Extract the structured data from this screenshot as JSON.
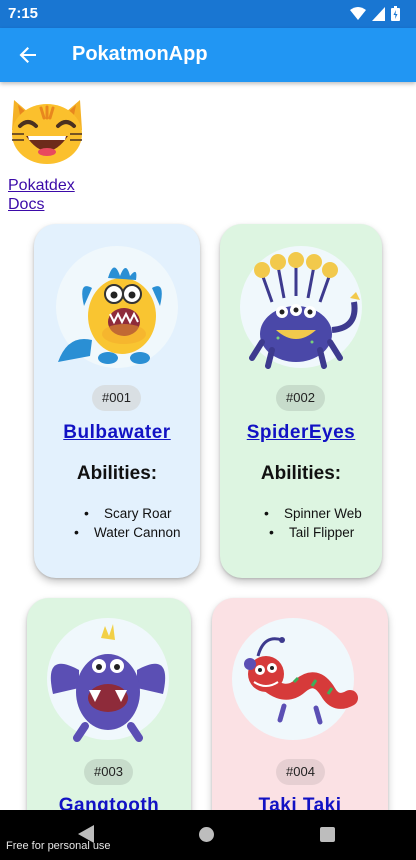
{
  "status_bar": {
    "time": "7:15"
  },
  "app_bar": {
    "title": "PokatmonApp"
  },
  "links": {
    "pokatdex": "Pokatdex",
    "docs": "Docs"
  },
  "cards": [
    {
      "number": "#001",
      "name": "Bulbawater",
      "abilities_title": "Abilities:",
      "abilities": [
        "Scary Roar",
        "Water Cannon"
      ],
      "color": "#e3f1fd"
    },
    {
      "number": "#002",
      "name": "SpiderEyes",
      "abilities_title": "Abilities:",
      "abilities": [
        "Spinner Web",
        "Tail Flipper"
      ],
      "color": "#ddf5e1"
    },
    {
      "number": "#003",
      "name": "Gangtooth",
      "color": "#ddf5e1"
    },
    {
      "number": "#004",
      "name": "Taki Taki",
      "color": "#fbe1e4"
    }
  ],
  "watermark": "Free for personal use",
  "icons": {
    "back": "arrow-back-icon",
    "logo": "grinning-cat-icon"
  }
}
